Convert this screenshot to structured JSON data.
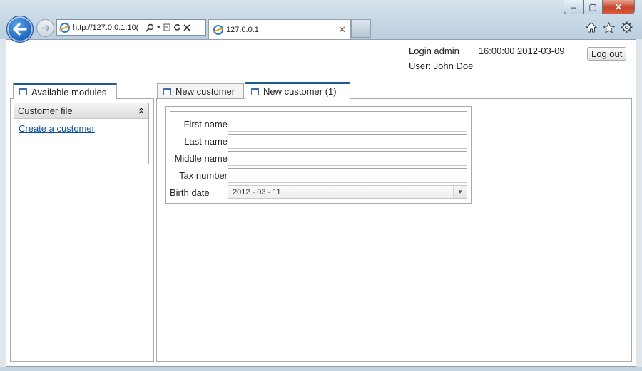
{
  "browser": {
    "url": "http://127.0.0.1:10(",
    "tab_title": "127.0.0.1",
    "window_controls": {
      "minimize": "‒",
      "maximize": "▢",
      "close": "✕"
    },
    "icons": [
      "home-icon",
      "star-icon",
      "gear-icon"
    ]
  },
  "header": {
    "login_text": "Login admin",
    "clock": "16:00:00 2012-03-09",
    "user_text": "User: John Doe",
    "logout_label": "Log out"
  },
  "left_panel": {
    "tab_label": "Available modules",
    "section": {
      "title": "Customer file",
      "links": [
        "Create a customer"
      ]
    }
  },
  "main": {
    "tabs": [
      {
        "label": "New customer",
        "active": false
      },
      {
        "label": "New customer (1)",
        "active": true
      }
    ],
    "form": {
      "fields": [
        {
          "label": "First name",
          "value": ""
        },
        {
          "label": "Last name",
          "value": ""
        },
        {
          "label": "Middle name",
          "value": ""
        },
        {
          "label": "Tax number",
          "value": ""
        }
      ],
      "birth_date": {
        "label": "Birth date",
        "value": "2012 - 03 - 11"
      }
    }
  },
  "colors": {
    "tab_accent": "#1e5c96",
    "link": "#0b4f9c",
    "close_button": "#c7452b"
  }
}
